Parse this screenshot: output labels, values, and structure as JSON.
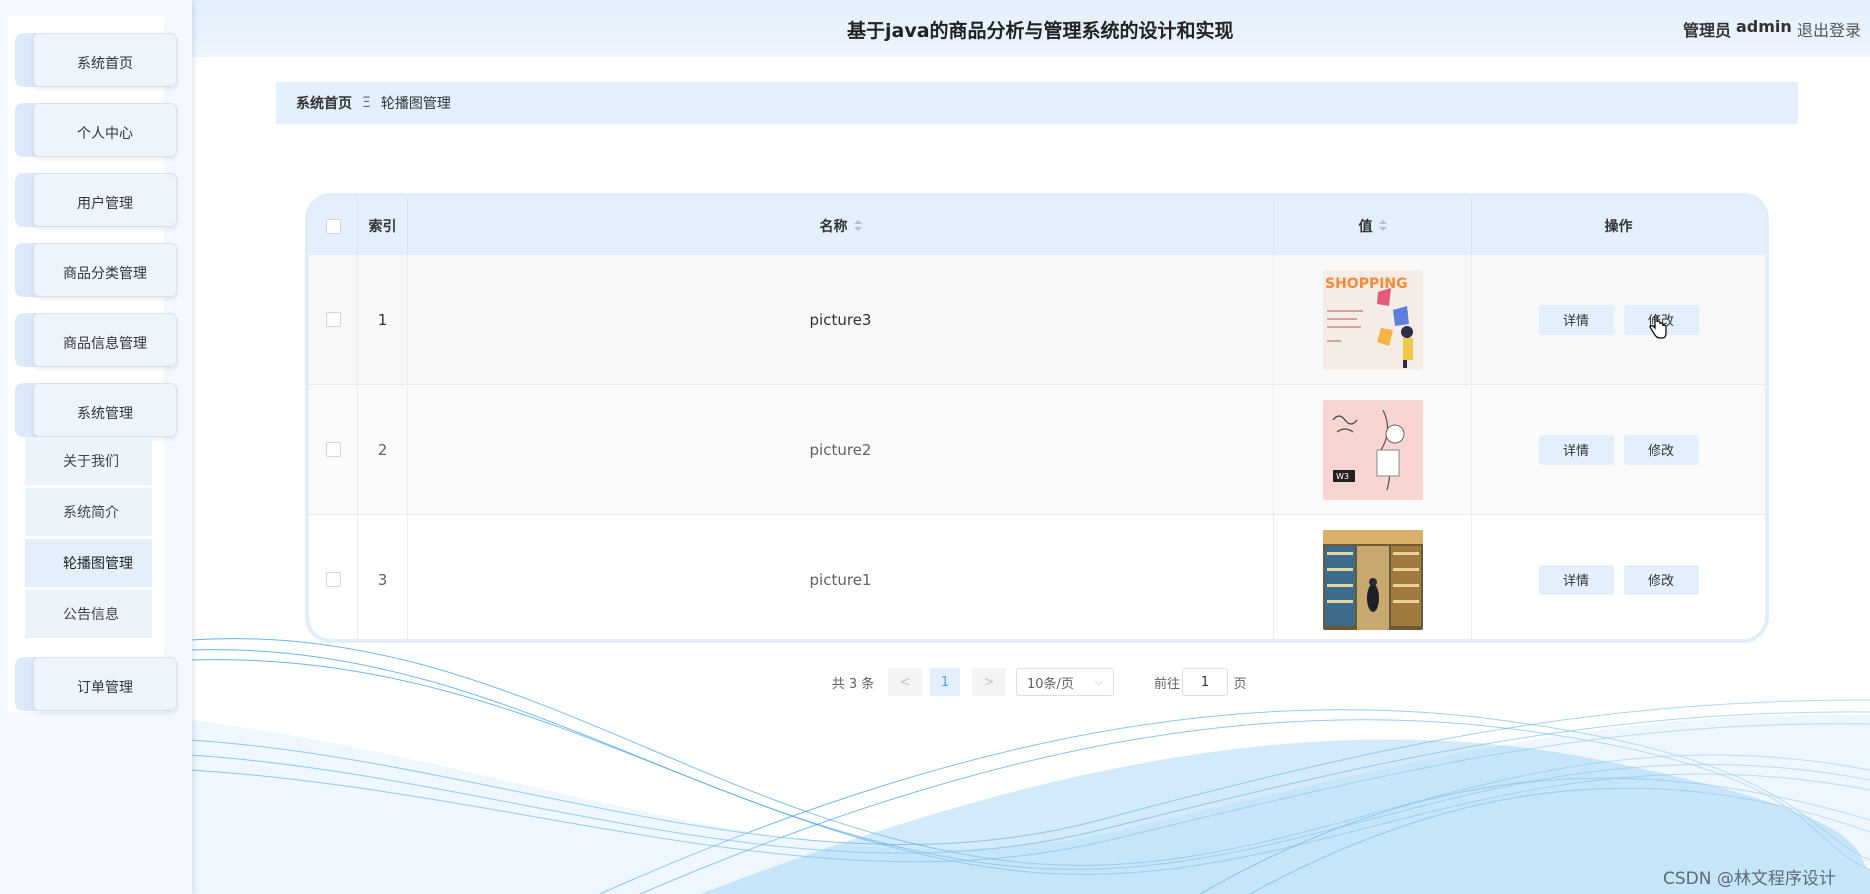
{
  "header": {
    "title": "基于java的商品分析与管理系统的设计和实现",
    "user_role": "管理员",
    "user_name": "admin",
    "logout_label": "退出登录"
  },
  "sidebar": {
    "items": [
      {
        "label": "系统首页"
      },
      {
        "label": "个人中心"
      },
      {
        "label": "用户管理"
      },
      {
        "label": "商品分类管理"
      },
      {
        "label": "商品信息管理"
      },
      {
        "label": "系统管理"
      },
      {
        "label": "订单管理"
      }
    ],
    "submenu": [
      {
        "label": "关于我们"
      },
      {
        "label": "系统简介"
      },
      {
        "label": "轮播图管理",
        "active": true
      },
      {
        "label": "公告信息"
      }
    ]
  },
  "breadcrumb": {
    "home": "系统首页",
    "separator": "Ξ",
    "current": "轮播图管理"
  },
  "table": {
    "columns": {
      "index": "索引",
      "name": "名称",
      "value": "值",
      "actions": "操作"
    },
    "rows": [
      {
        "index": "1",
        "name": "picture3",
        "image": "shopping-banner"
      },
      {
        "index": "2",
        "name": "picture2",
        "image": "pink-fashion-sketch"
      },
      {
        "index": "3",
        "name": "picture1",
        "image": "supermarket-aisle"
      }
    ],
    "detail_label": "详情",
    "edit_label": "修改"
  },
  "pagination": {
    "total_text": "共 3 条",
    "prev": "<",
    "current_page": "1",
    "next": ">",
    "page_size": "10条/页",
    "goto_label": "前往",
    "goto_value": "1",
    "page_suffix": "页"
  },
  "watermark": "CSDN @林文程序设计",
  "colors": {
    "accent": "#e3effc",
    "active_page": "#409eff"
  }
}
